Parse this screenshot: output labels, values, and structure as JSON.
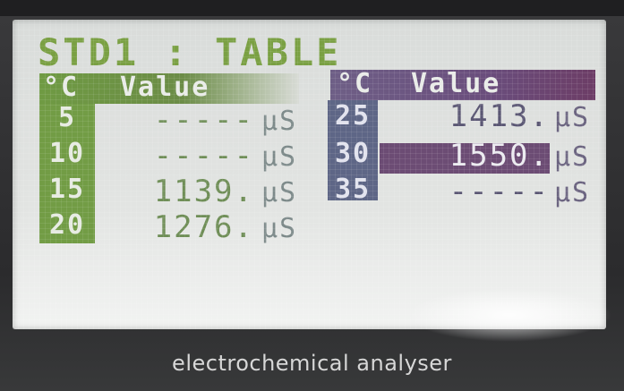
{
  "screen": {
    "title": "STD1 : TABLE",
    "header_left": {
      "temp_label": "°C",
      "value_label": "Value"
    },
    "header_right": {
      "temp_label": "°C",
      "value_label": "Value"
    },
    "rows_left": [
      {
        "temp": "5",
        "value": "-----",
        "unit": "µS"
      },
      {
        "temp": "10",
        "value": "-----",
        "unit": "µS"
      },
      {
        "temp": "15",
        "value": "1139.",
        "unit": "µS"
      },
      {
        "temp": "20",
        "value": "1276.",
        "unit": "µS"
      }
    ],
    "rows_right": [
      {
        "temp": "25",
        "value": "1413.",
        "unit": "µS"
      },
      {
        "temp": "30",
        "value": "1550.",
        "unit": "µS"
      },
      {
        "temp": "35",
        "value": "-----",
        "unit": "µS"
      }
    ]
  },
  "device": {
    "caption": "electrochemical analyser"
  },
  "colors": {
    "lcd_background": "#e0e2e0",
    "green_accent": "#729c45",
    "purple_accent": "#6a4d7c",
    "blue_accent": "#5e6686"
  }
}
